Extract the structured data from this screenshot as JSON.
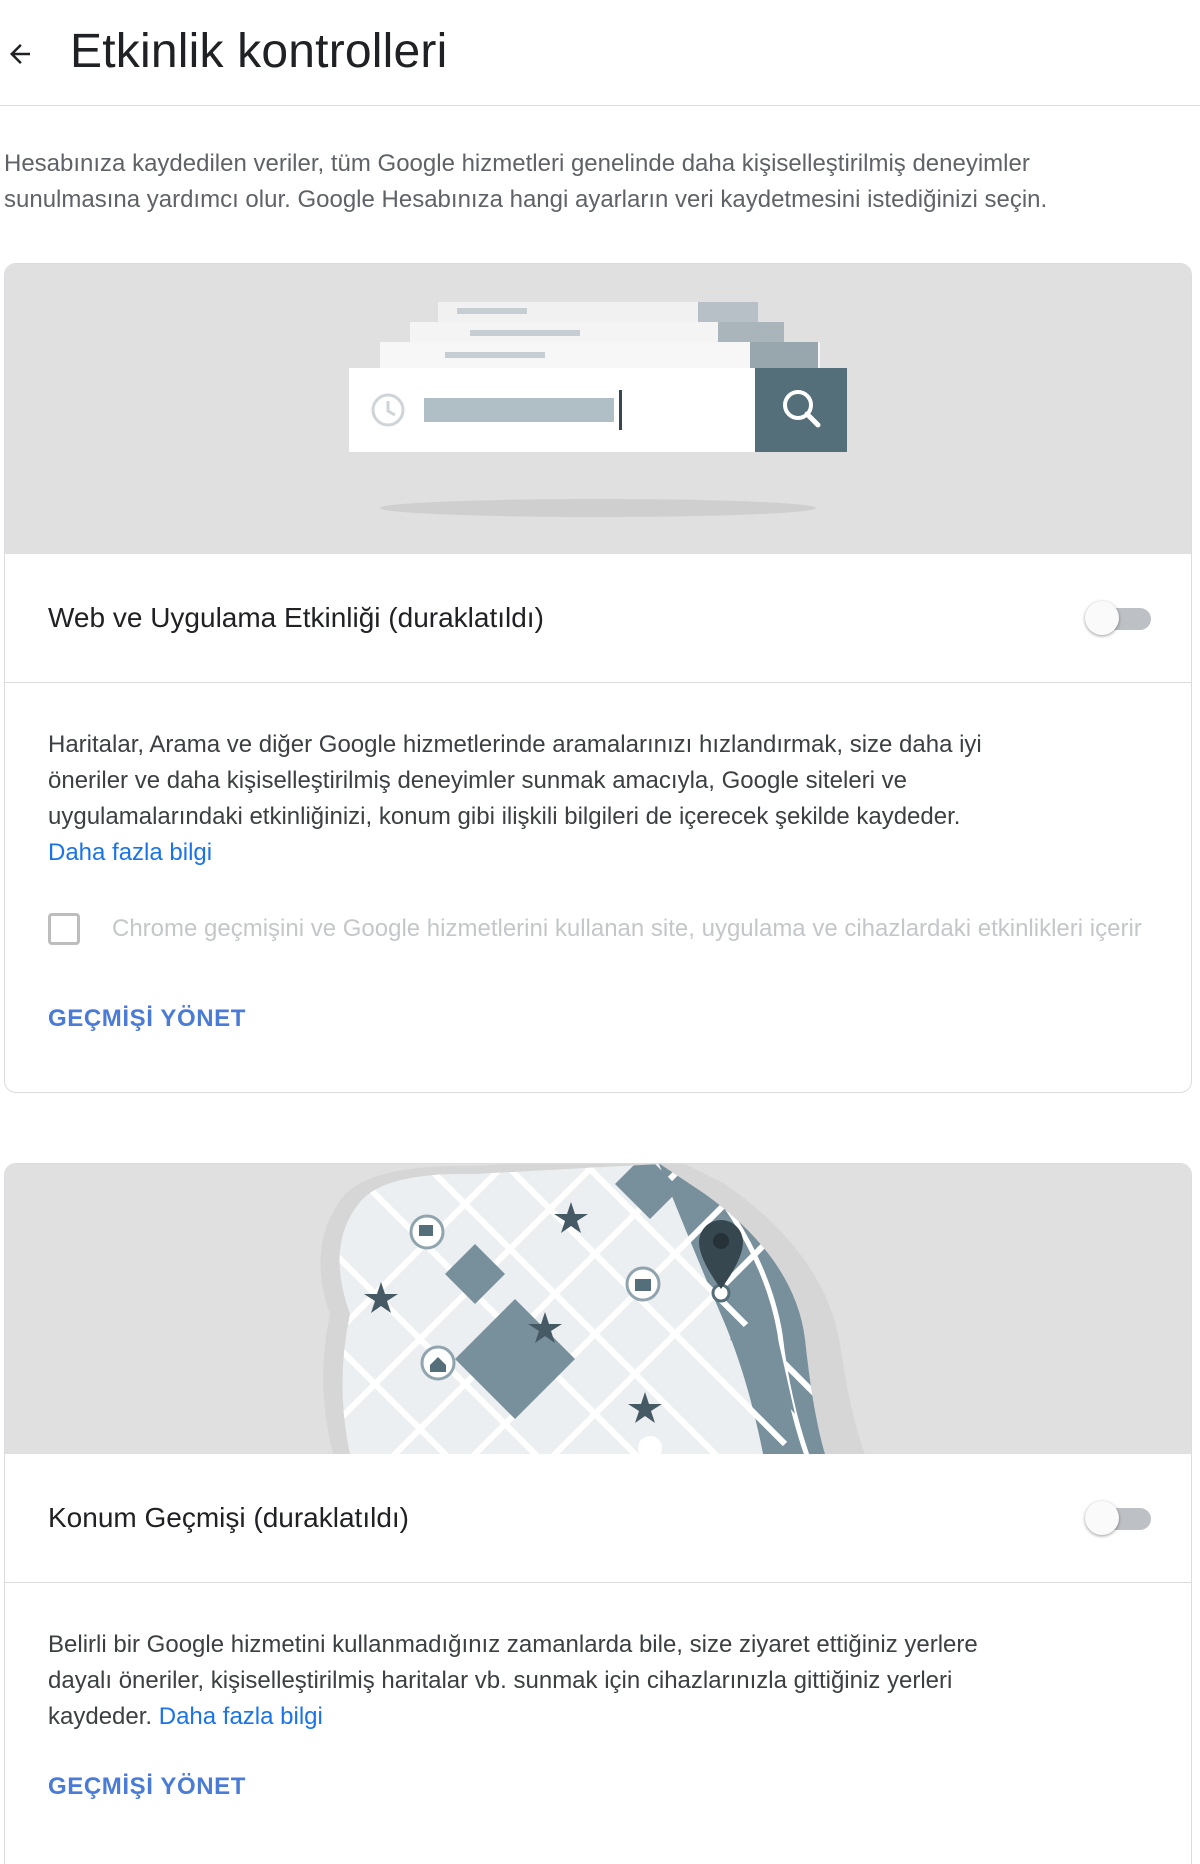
{
  "header": {
    "title": "Etkinlik kontrolleri"
  },
  "intro": "Hesabınıza kaydedilen veriler, tüm Google hizmetleri genelinde daha kişiselleştirilmiş deneyimler sunulmasına yardımcı olur. Google Hesabınıza hangi ayarların veri kaydetmesini istediğinizi seçin.",
  "web_activity": {
    "title": "Web ve Uygulama Etkinliği (duraklatıldı)",
    "toggle_on": false,
    "description": "Haritalar, Arama ve diğer Google hizmetlerinde aramalarınızı hızlandırmak, size daha iyi öneriler ve daha kişiselleştirilmiş deneyimler sunmak amacıyla, Google siteleri ve uygulamalarındaki etkinliğinizi, konum gibi ilişkili bilgileri de içerecek şekilde kaydeder.",
    "learn_more": "Daha fazla bilgi",
    "checkbox_label": "Chrome geçmişini ve Google hizmetlerini kullanan site, uygulama ve cihazlardaki etkinlikleri içerir",
    "checkbox_checked": false,
    "manage_label": "GEÇMİŞİ YÖNET"
  },
  "location_history": {
    "title": "Konum Geçmişi (duraklatıldı)",
    "toggle_on": false,
    "description": "Belirli bir Google hizmetini kullanmadığınız zamanlarda bile, size ziyaret ettiğiniz yerlere dayalı öneriler, kişiselleştirilmiş haritalar vb. sunmak için cihazlarınızla gittiğiniz yerleri kaydeder.",
    "learn_more": "Daha fazla bilgi",
    "manage_label": "GEÇMİŞİ YÖNET"
  },
  "colors": {
    "accent_link": "#1a73e8",
    "manage_link": "#4a7bd6",
    "illustration_dark": "#546e7a",
    "banner_bg": "#e0e0e0"
  },
  "icons": [
    "back-arrow-icon",
    "search-illustration",
    "map-illustration"
  ]
}
